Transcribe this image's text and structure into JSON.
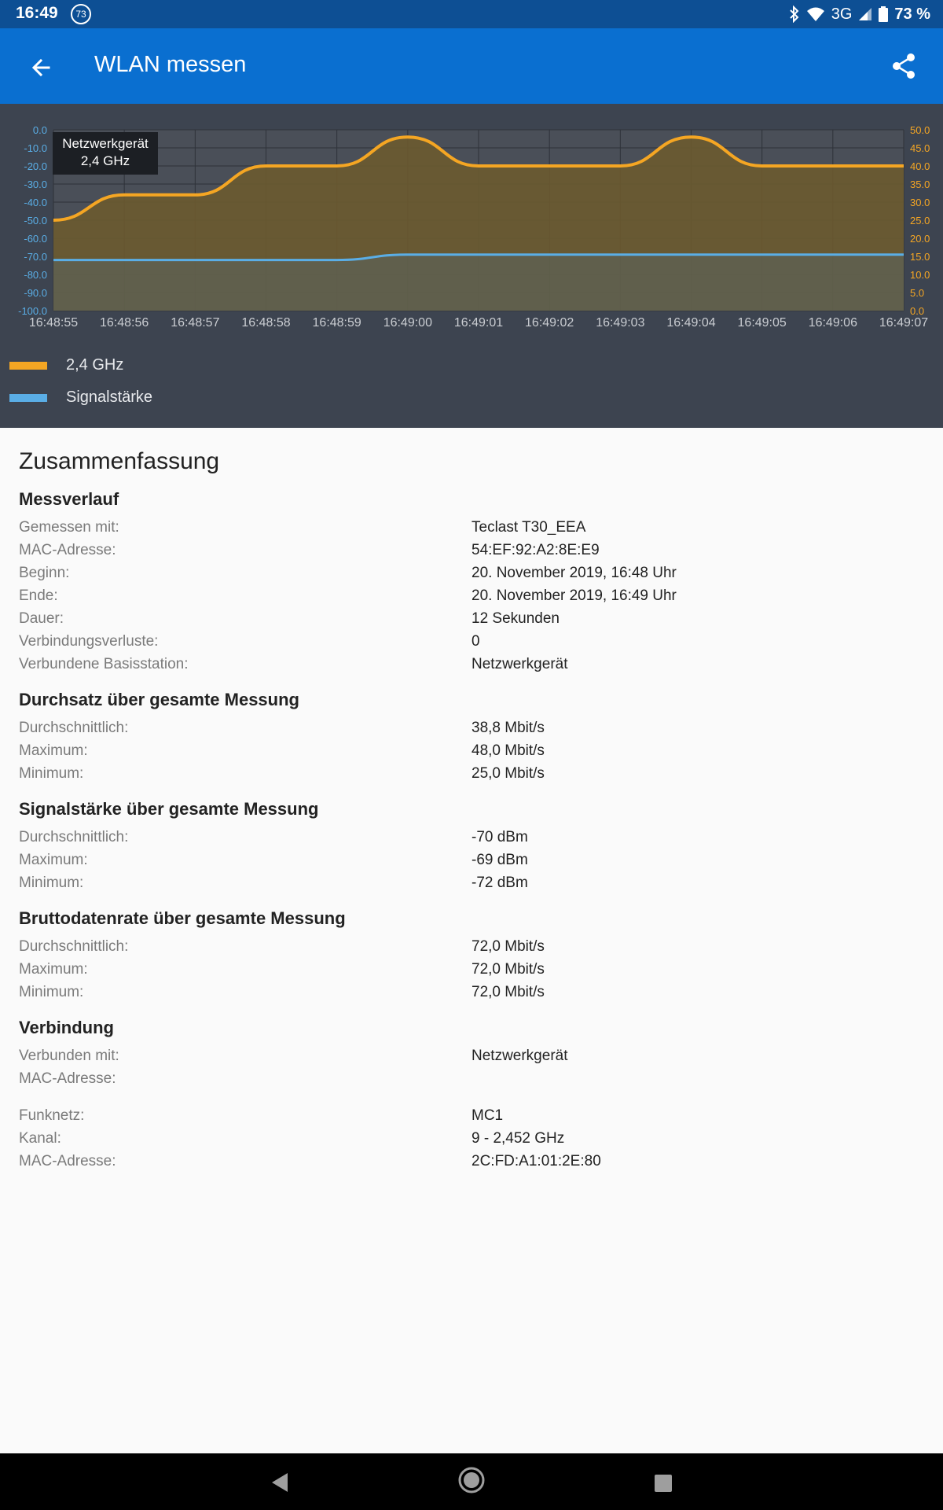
{
  "status_bar": {
    "time": "16:49",
    "badge": "73",
    "network": "3G",
    "battery": "73 %"
  },
  "app_bar": {
    "title": "WLAN messen",
    "back_icon": "arrow-left-icon",
    "share_icon": "share-icon"
  },
  "chart": {
    "tooltip_line1": "Netzwerkgerät",
    "tooltip_line2": "2,4 GHz",
    "legend": [
      {
        "label": "2,4 GHz",
        "color": "#f5a623"
      },
      {
        "label": "Signalstärke",
        "color": "#5aaee6"
      }
    ]
  },
  "chart_data": {
    "type": "line",
    "x": [
      "16:48:55",
      "16:48:56",
      "16:48:57",
      "16:48:58",
      "16:48:59",
      "16:49:00",
      "16:49:01",
      "16:49:02",
      "16:49:03",
      "16:49:04",
      "16:49:05",
      "16:49:06",
      "16:49:07"
    ],
    "series": [
      {
        "name": "2,4 GHz",
        "axis": "right",
        "color": "#f5a623",
        "values": [
          25,
          32,
          32,
          40,
          40,
          48,
          40,
          40,
          40,
          48,
          40,
          40,
          40
        ]
      },
      {
        "name": "Signalstärke",
        "axis": "left",
        "color": "#5aaee6",
        "values": [
          -72,
          -72,
          -72,
          -72,
          -72,
          -69,
          -69,
          -69,
          -69,
          -69,
          -69,
          -69,
          -69
        ]
      }
    ],
    "y_left": {
      "range": [
        -100,
        0
      ],
      "ticks": [
        "0.0",
        "-10.0",
        "-20.0",
        "-30.0",
        "-40.0",
        "-50.0",
        "-60.0",
        "-70.0",
        "-80.0",
        "-90.0",
        "-100.0"
      ],
      "color": "#5aaee6"
    },
    "y_right": {
      "range": [
        0,
        50
      ],
      "ticks": [
        "50.0",
        "45.0",
        "40.0",
        "35.0",
        "30.0",
        "25.0",
        "20.0",
        "15.0",
        "10.0",
        "5.0",
        "0.0"
      ],
      "color": "#f5a623"
    },
    "grid": true,
    "legend_position": "bottom-left"
  },
  "summary": {
    "title": "Zusammenfassung",
    "sections": [
      {
        "title": "Messverlauf",
        "rows": [
          {
            "label": "Gemessen mit:",
            "value": "Teclast T30_EEA"
          },
          {
            "label": "MAC-Adresse:",
            "value": "54:EF:92:A2:8E:E9"
          },
          {
            "label": "Beginn:",
            "value": "20. November 2019, 16:48 Uhr"
          },
          {
            "label": "Ende:",
            "value": "20. November 2019, 16:49 Uhr"
          },
          {
            "label": "Dauer:",
            "value": "12 Sekunden"
          },
          {
            "label": "Verbindungsverluste:",
            "value": "0"
          },
          {
            "label": "Verbundene Basisstation:",
            "value": "Netzwerkgerät"
          }
        ]
      },
      {
        "title": "Durchsatz über gesamte Messung",
        "rows": [
          {
            "label": "Durchschnittlich:",
            "value": "38,8 Mbit/s"
          },
          {
            "label": "Maximum:",
            "value": "48,0 Mbit/s"
          },
          {
            "label": "Minimum:",
            "value": "25,0 Mbit/s"
          }
        ]
      },
      {
        "title": "Signalstärke über gesamte Messung",
        "rows": [
          {
            "label": "Durchschnittlich:",
            "value": "-70 dBm"
          },
          {
            "label": "Maximum:",
            "value": "-69 dBm"
          },
          {
            "label": "Minimum:",
            "value": "-72 dBm"
          }
        ]
      },
      {
        "title": "Bruttodatenrate über gesamte Messung",
        "rows": [
          {
            "label": "Durchschnittlich:",
            "value": "72,0 Mbit/s"
          },
          {
            "label": "Maximum:",
            "value": "72,0 Mbit/s"
          },
          {
            "label": "Minimum:",
            "value": "72,0 Mbit/s"
          }
        ]
      },
      {
        "title": "Verbindung",
        "rows": [
          {
            "label": "Verbunden mit:",
            "value": "Netzwerkgerät"
          },
          {
            "label": "MAC-Adresse:",
            "value": ""
          }
        ],
        "rows2": [
          {
            "label": "Funknetz:",
            "value": "MC1"
          },
          {
            "label": "Kanal:",
            "value": "9 - 2,452 GHz"
          },
          {
            "label": "MAC-Adresse:",
            "value": "2C:FD:A1:01:2E:80"
          }
        ]
      }
    ]
  },
  "nav_bar": {
    "back_icon": "nav-back-icon",
    "home_icon": "nav-home-icon",
    "recent_icon": "nav-recent-icon"
  }
}
